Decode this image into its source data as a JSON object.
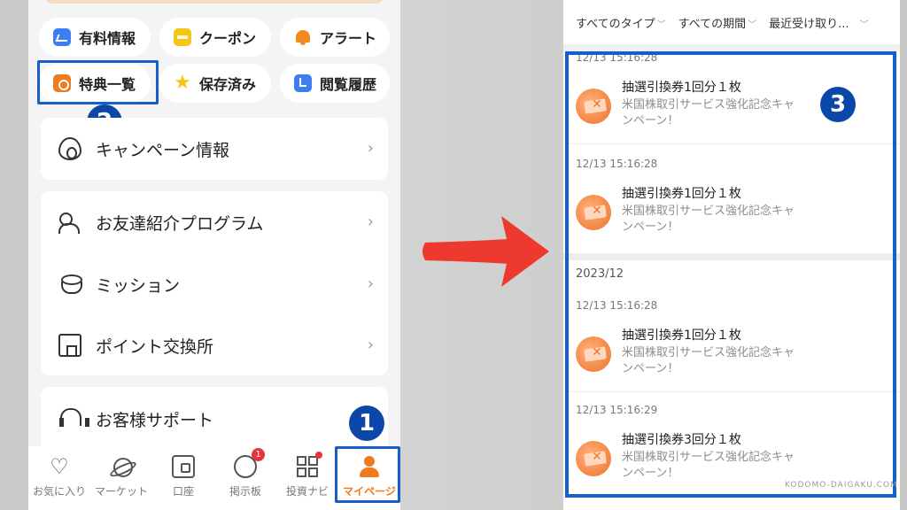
{
  "left": {
    "chips": [
      {
        "id": "paid",
        "label": "有料情報",
        "icon": "chart-icon"
      },
      {
        "id": "coupon",
        "label": "クーポン",
        "icon": "coupon-icon"
      },
      {
        "id": "alert",
        "label": "アラート",
        "icon": "bell-icon"
      },
      {
        "id": "benefits",
        "label": "特典一覧",
        "icon": "gift-bag-icon"
      },
      {
        "id": "saved",
        "label": "保存済み",
        "icon": "star-icon"
      },
      {
        "id": "history",
        "label": "閲覧履歴",
        "icon": "history-icon"
      }
    ],
    "menu": {
      "campaign": "キャンペーン情報",
      "referral": "お友達紹介プログラム",
      "mission": "ミッション",
      "points": "ポイント交換所",
      "support": "お客様サポート"
    },
    "nav": [
      {
        "label": "お気に入り",
        "icon": "heart-icon"
      },
      {
        "label": "マーケット",
        "icon": "planet-icon"
      },
      {
        "label": "口座",
        "icon": "wallet-icon"
      },
      {
        "label": "掲示板",
        "icon": "board-icon",
        "badge": "1"
      },
      {
        "label": "投資ナビ",
        "icon": "grid-icon"
      },
      {
        "label": "マイページ",
        "icon": "person-icon",
        "active": true
      }
    ],
    "steps": {
      "one": "1",
      "two": "2"
    },
    "colors": {
      "accent": "#f07a1e",
      "highlight": "#1460c8",
      "badge": "#0b47a8"
    }
  },
  "right": {
    "filters": {
      "type": "すべてのタイプ",
      "period": "すべての期間",
      "sort": "最近受け取り..."
    },
    "month_label": "2023/12",
    "entries": [
      {
        "time": "12/13 15:16:28",
        "title": "抽選引換券1回分１枚",
        "desc": "米国株取引サービス強化記念キャンペーン！"
      },
      {
        "time": "12/13 15:16:28",
        "title": "抽選引換券1回分１枚",
        "desc": "米国株取引サービス強化記念キャンペーン！"
      },
      {
        "time": "12/13 15:16:28",
        "title": "抽選引換券1回分１枚",
        "desc": "米国株取引サービス強化記念キャンペーン！"
      },
      {
        "time": "12/13 15:16:29",
        "title": "抽選引換券3回分１枚",
        "desc": "米国株取引サービス強化記念キャンペーン！"
      }
    ],
    "step_three": "3"
  },
  "watermark": "KODOMO-DAIGAKU.COM"
}
